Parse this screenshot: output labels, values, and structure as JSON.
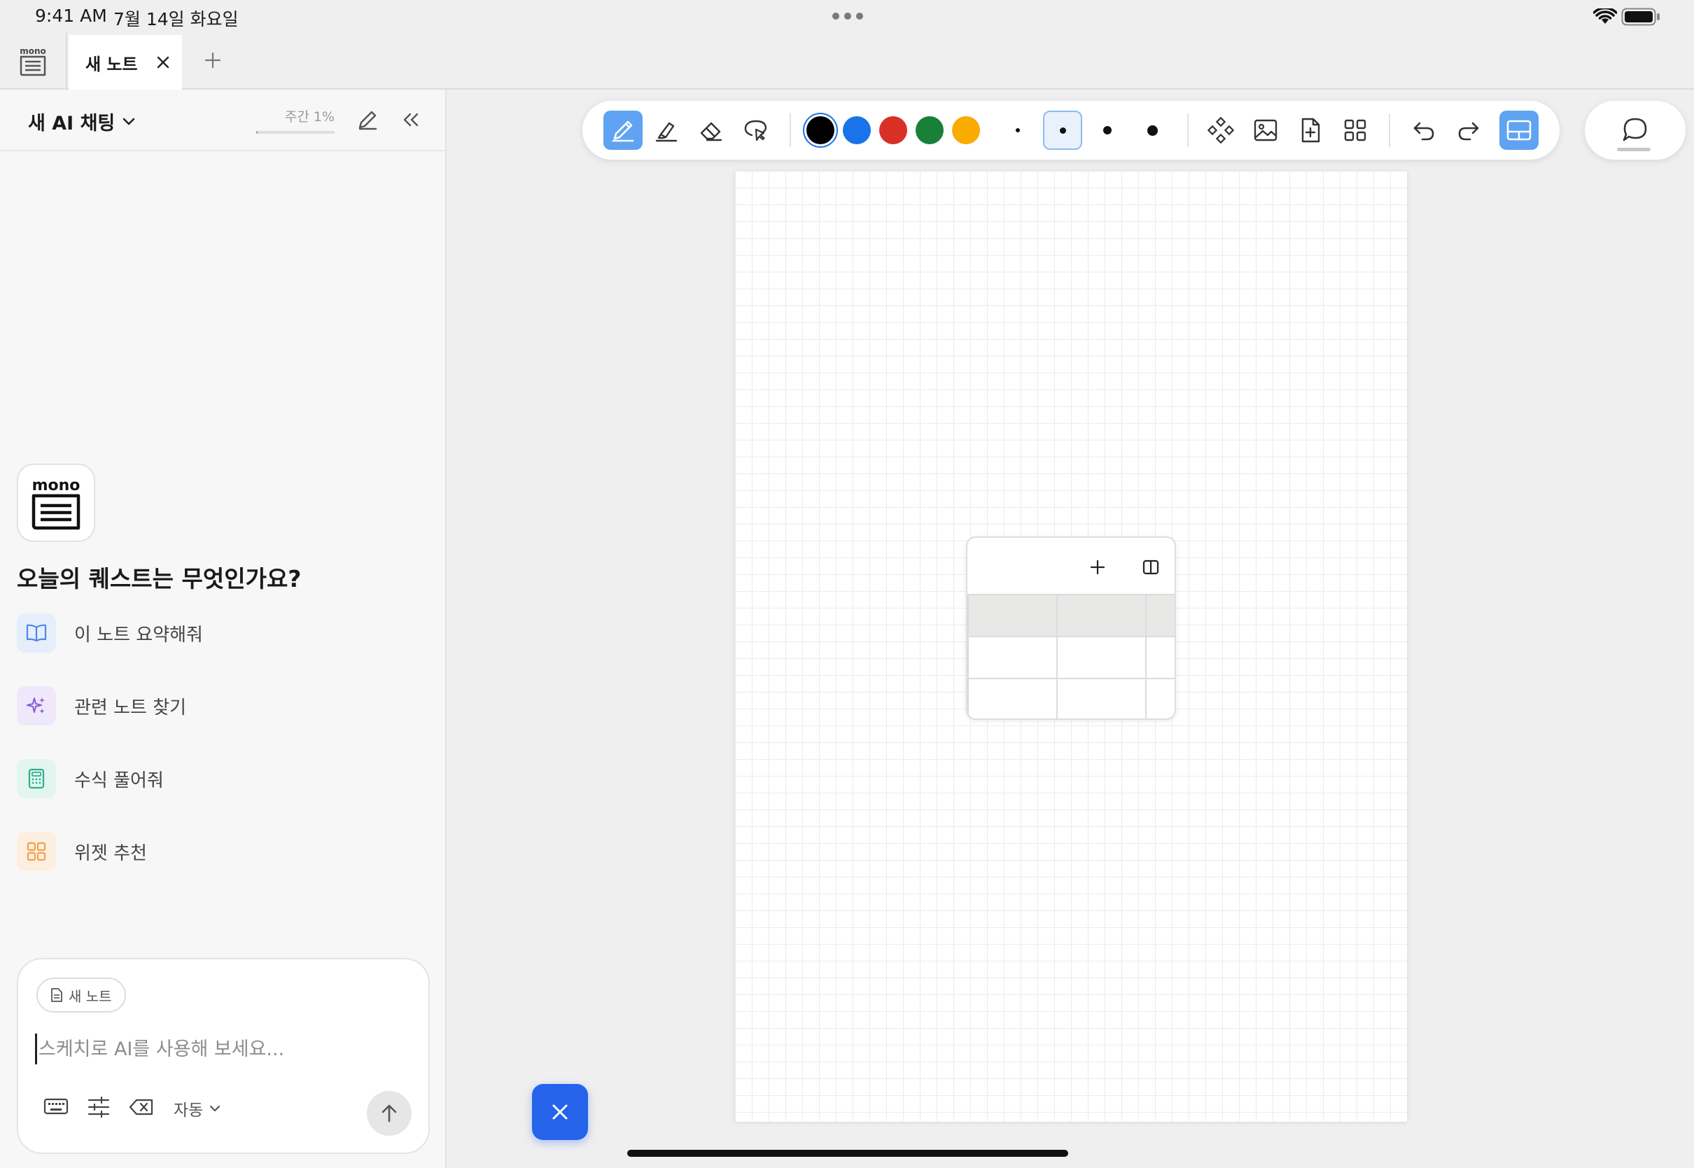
{
  "status_bar": {
    "time": "9:41 AM",
    "date": "7월 14일 화요일"
  },
  "tabs": [
    {
      "label": "새 노트"
    }
  ],
  "chat_panel": {
    "title": "새 AI 채팅",
    "weekly_usage": {
      "label": "주간 1%",
      "percent": 1
    },
    "heading": "오늘의 퀘스트는 무엇인가요?",
    "suggestions": [
      {
        "label": "이 노트 요약해줘",
        "icon": "book-icon",
        "color": "#4f86e8",
        "bg": "#e6eefb"
      },
      {
        "label": "관련 노트 찾기",
        "icon": "sparkle-icon",
        "color": "#8a5cd6",
        "bg": "#efe8fa"
      },
      {
        "label": "수식 풀어줘",
        "icon": "calculator-icon",
        "color": "#2fae8f",
        "bg": "#e3f5ef"
      },
      {
        "label": "위젯 추천",
        "icon": "grid-icon",
        "color": "#f0a04b",
        "bg": "#fdefdf"
      }
    ],
    "input": {
      "context_chip": "새 노트",
      "placeholder": "스케치로 AI를 사용해 보세요...",
      "mode": "자동"
    }
  },
  "toolbar": {
    "colors": [
      {
        "name": "black",
        "hex": "#000000",
        "selected": true
      },
      {
        "name": "blue",
        "hex": "#1a73e8"
      },
      {
        "name": "red",
        "hex": "#d93025"
      },
      {
        "name": "green",
        "hex": "#188038"
      },
      {
        "name": "yellow",
        "hex": "#f9ab00"
      }
    ],
    "active_tool": "pen",
    "selected_stroke_index": 1
  },
  "accent_color": "#2563eb"
}
